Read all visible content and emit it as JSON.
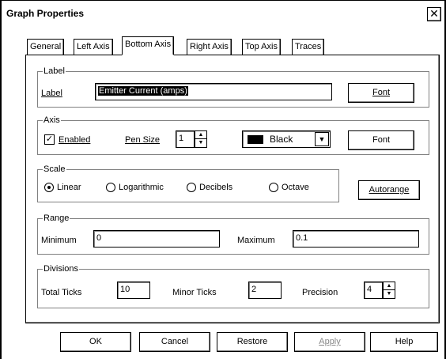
{
  "window": {
    "title": "Graph Properties",
    "close_glyph": "✕"
  },
  "tabs": [
    {
      "label": "General",
      "active": false
    },
    {
      "label": "Left Axis",
      "active": false
    },
    {
      "label": "Bottom Axis",
      "active": true
    },
    {
      "label": "Right Axis",
      "active": false
    },
    {
      "label": "Top Axis",
      "active": false
    },
    {
      "label": "Traces",
      "active": false
    }
  ],
  "label_group": {
    "legend": "Label",
    "field_label": "Label",
    "value": "Emitter Current (amps)",
    "font_button": "Font"
  },
  "axis_group": {
    "legend": "Axis",
    "enabled_label": "Enabled",
    "enabled_checked": true,
    "pen_size_label": "Pen Size",
    "pen_size_value": "1",
    "color_value": "Black",
    "color_swatch": "#000000",
    "font_button": "Font"
  },
  "scale_group": {
    "legend": "Scale",
    "options": [
      {
        "label": "Linear",
        "selected": true
      },
      {
        "label": "Logarithmic",
        "selected": false
      },
      {
        "label": "Decibels",
        "selected": false
      },
      {
        "label": "Octave",
        "selected": false
      }
    ],
    "autorange_button": "Autorange"
  },
  "range_group": {
    "legend": "Range",
    "minimum_label": "Minimum",
    "minimum_value": "0",
    "maximum_label": "Maximum",
    "maximum_value": "0.1"
  },
  "divisions_group": {
    "legend": "Divisions",
    "total_ticks_label": "Total Ticks",
    "total_ticks_value": "10",
    "minor_ticks_label": "Minor Ticks",
    "minor_ticks_value": "2",
    "precision_label": "Precision",
    "precision_value": "4"
  },
  "buttons": {
    "ok": "OK",
    "cancel": "Cancel",
    "restore": "Restore",
    "apply": "Apply",
    "help": "Help"
  }
}
